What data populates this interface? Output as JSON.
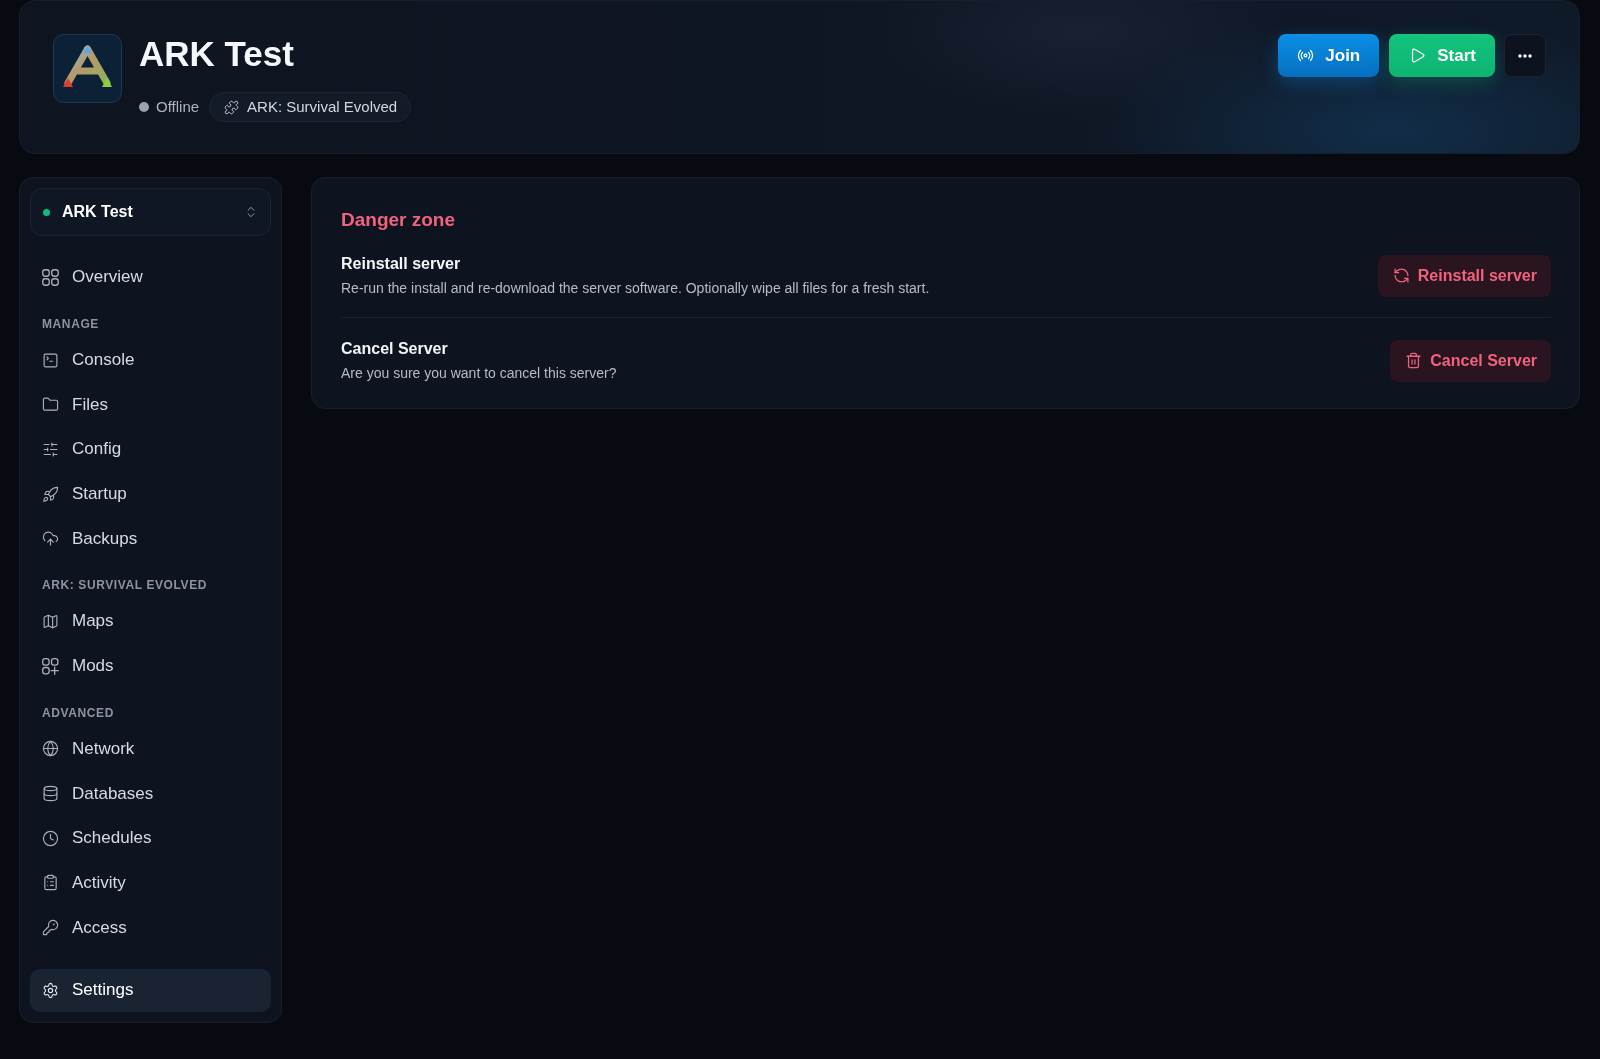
{
  "header": {
    "title": "ARK Test",
    "status": {
      "label": "Offline",
      "online": false
    },
    "game_tag": "ARK: Survival Evolved",
    "actions": [
      {
        "kind": "join",
        "label": "Join"
      },
      {
        "kind": "start",
        "label": "Start"
      },
      {
        "kind": "more"
      }
    ]
  },
  "sidebar": {
    "server": {
      "name": "ARK Test",
      "online": true
    },
    "sections": [
      {
        "items": [
          {
            "label": "Overview",
            "selected": false
          }
        ]
      },
      {
        "heading": "MANAGE",
        "items": [
          {
            "label": "Console",
            "selected": false
          },
          {
            "label": "Files",
            "selected": false
          },
          {
            "label": "Config",
            "selected": false
          },
          {
            "label": "Startup",
            "selected": false
          },
          {
            "label": "Backups",
            "selected": false
          }
        ]
      },
      {
        "heading": "ARK: SURVIVAL EVOLVED",
        "items": [
          {
            "label": "Maps",
            "selected": false
          },
          {
            "label": "Mods",
            "selected": false
          }
        ]
      },
      {
        "heading": "ADVANCED",
        "items": [
          {
            "label": "Network",
            "selected": false
          },
          {
            "label": "Databases",
            "selected": false
          },
          {
            "label": "Schedules",
            "selected": false
          },
          {
            "label": "Activity",
            "selected": false
          },
          {
            "label": "Access",
            "selected": false
          }
        ]
      }
    ],
    "footer_items": [
      {
        "label": "Settings",
        "selected": true
      }
    ]
  },
  "danger_zone": {
    "title": "Danger zone",
    "actions": [
      {
        "title": "Reinstall server",
        "description": "Re-run the install and re-download the server software. Optionally wipe all files for a fresh start.",
        "button": "Reinstall server"
      },
      {
        "title": "Cancel Server",
        "description": "Are you sure you want to cancel this server?",
        "button": "Cancel Server"
      }
    ]
  }
}
